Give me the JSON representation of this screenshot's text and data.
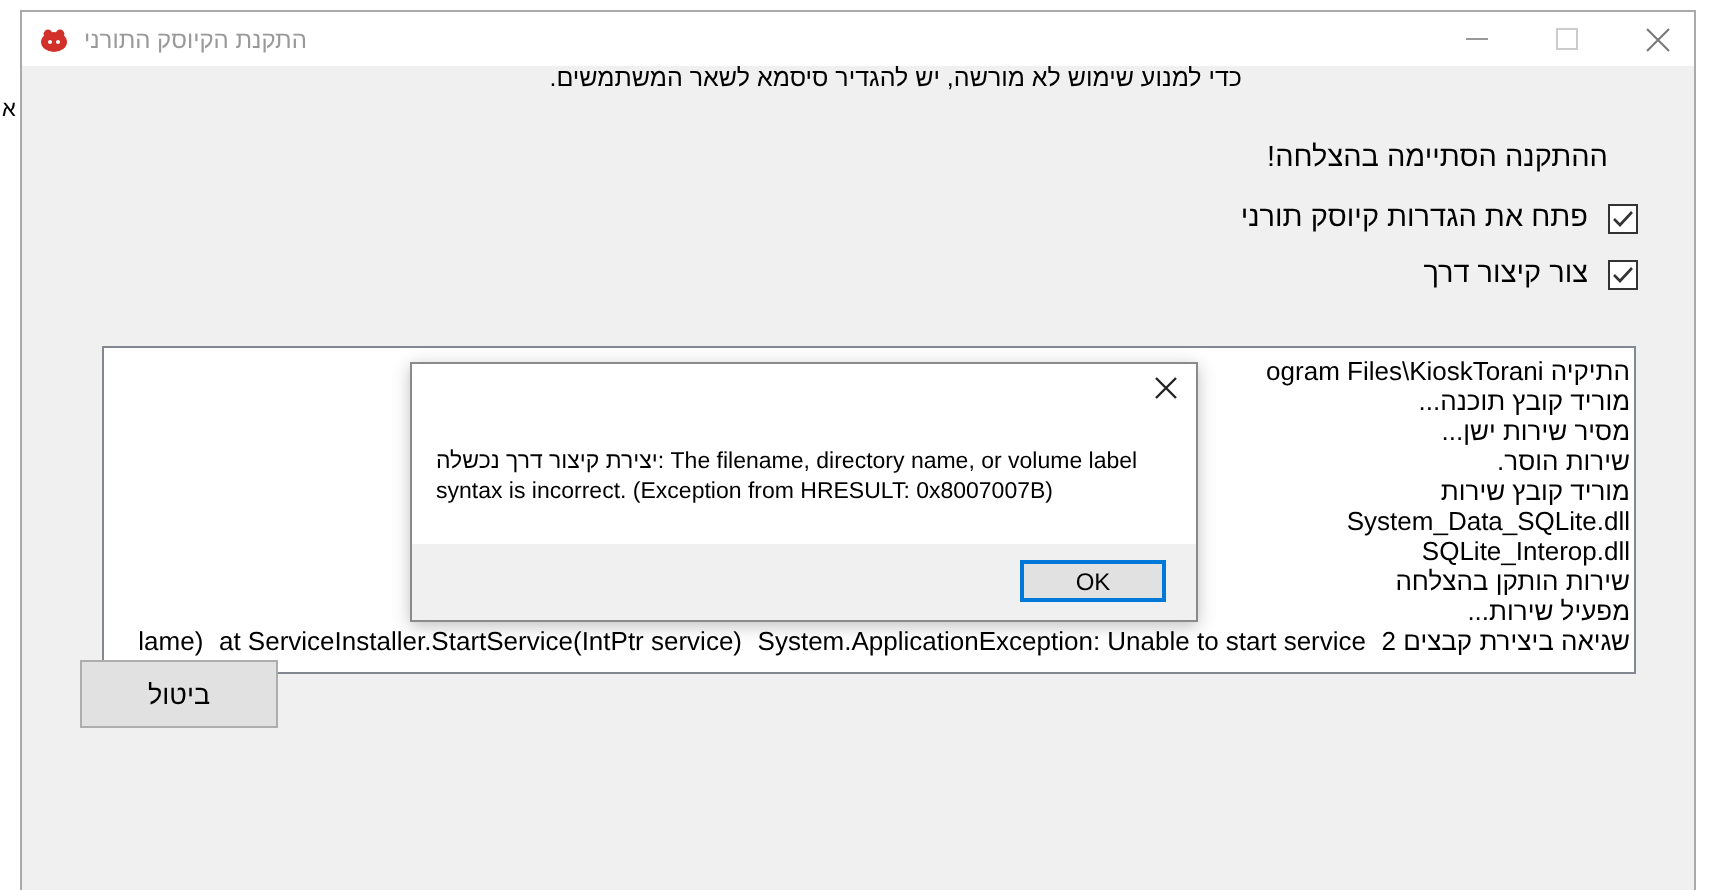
{
  "background_window": {
    "text": "א"
  },
  "window": {
    "title": "התקנת הקיוסק התורני"
  },
  "notice": "כדי למנוע שימוש לא מורשה, יש להגדיר סיסמא לשאר המשתמשים.",
  "heading": "ההתקנה הסתיימה בהצלחה!",
  "options": [
    {
      "label": "פתח את הגדרות קיוסק תורני",
      "checked": true
    },
    {
      "label": "צור קיצור דרך",
      "checked": true
    }
  ],
  "log": [
    {
      "parts": [
        "התיקיה",
        "ogram Files\\KioskTorani"
      ]
    },
    {
      "parts": [
        "מוריד קובץ תוכנה..."
      ]
    },
    {
      "parts": [
        "מסיר שירות ישן..."
      ]
    },
    {
      "parts": [
        "שירות הוסר."
      ]
    },
    {
      "parts": [
        "מוריד קובץ שירות"
      ]
    },
    {
      "parts": [
        "System_Data_SQLite.dll"
      ]
    },
    {
      "parts": [
        "SQLite_Interop.dll"
      ]
    },
    {
      "parts": [
        "שירות הותקן בהצלחה"
      ]
    },
    {
      "parts": [
        "מפעיל שירות..."
      ]
    },
    {
      "parts": [
        "שגיאה ביצירת קבצים 2",
        "System.ApplicationException: Unable to start service",
        "at ServiceInstaller.StartService(IntPtr service)",
        "lame)"
      ]
    }
  ],
  "cancel_button": "ביטול",
  "dialog": {
    "message": "יצירת קיצור דרך נכשלה: The filename, directory name, or volume label syntax is incorrect. (Exception from HRESULT: 0x8007007B)",
    "ok_button": "OK"
  }
}
